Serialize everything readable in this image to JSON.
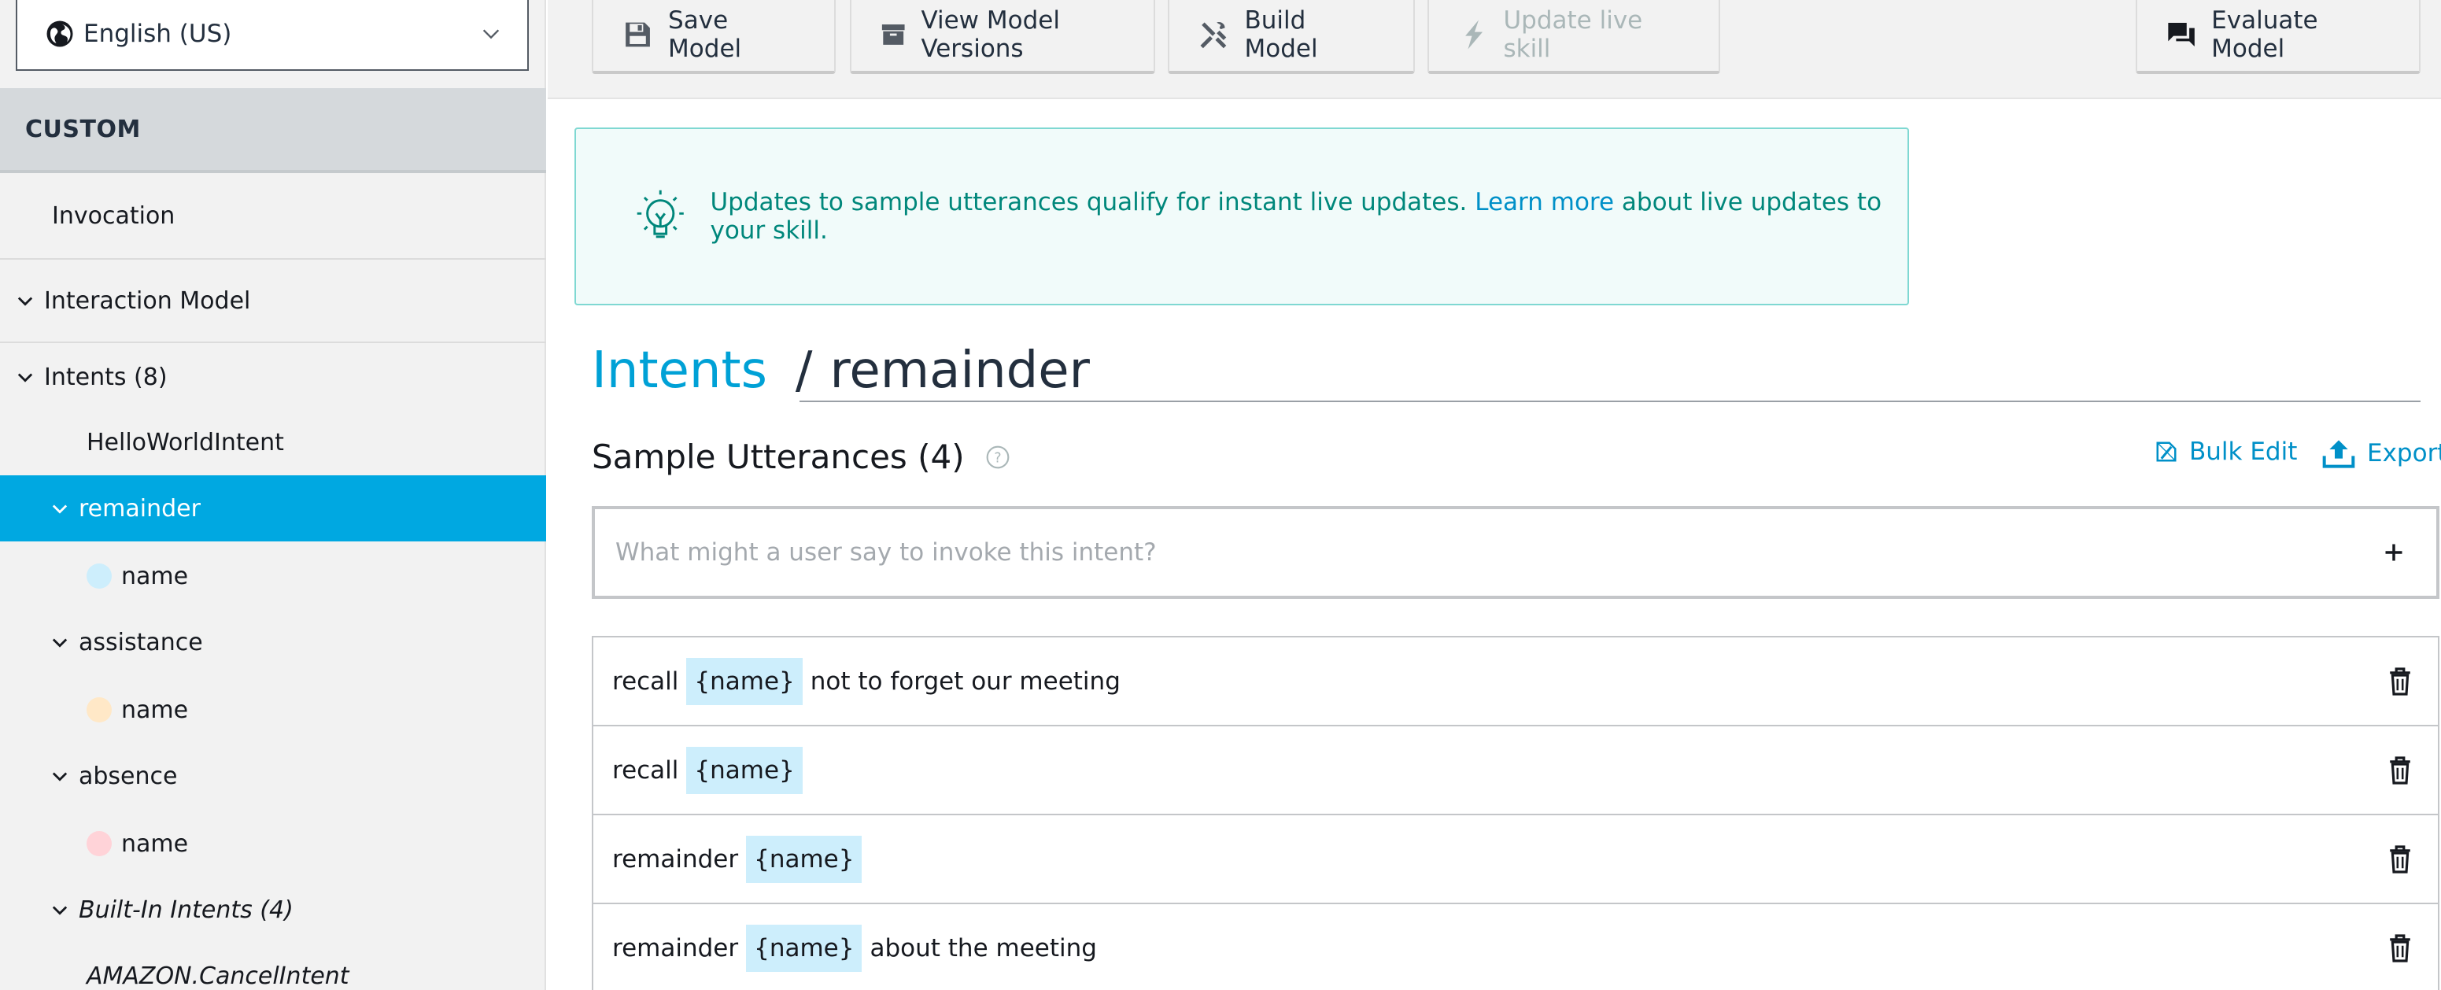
{
  "sidebar": {
    "language": "English (US)",
    "section_header": "CUSTOM",
    "invocation": "Invocation",
    "interaction_model": "Interaction Model",
    "intents_label": "Intents (8)",
    "hello_world": "HelloWorldIntent",
    "remainder": "remainder",
    "remainder_slot": "name",
    "assistance": "assistance",
    "assistance_slot": "name",
    "absence": "absence",
    "absence_slot": "name",
    "builtin_label": "Built-In Intents (4)",
    "cancel_intent": "AMAZON.CancelIntent",
    "slot_colors": [
      "#cdeefc",
      "#ffe8c7",
      "#ffd3d8"
    ]
  },
  "toolbar": {
    "save_model": "Save Model",
    "view_versions": "View Model Versions",
    "build_model": "Build Model",
    "update_live": "Update live skill",
    "evaluate_model": "Evaluate Model"
  },
  "banner": {
    "text_before": "Updates to sample utterances qualify for instant live updates.",
    "link": "Learn more",
    "text_after": "about live updates to your skill."
  },
  "breadcrumb": {
    "parent": "Intents",
    "separator": "/",
    "current": "remainder"
  },
  "utterances": {
    "title": "Sample Utterances (4)",
    "bulk_edit": "Bulk Edit",
    "export": "Export",
    "placeholder": "What might a user say to invoke this intent?",
    "rows": [
      {
        "before": "recall",
        "slot": "{name}",
        "after": "not to forget our meeting"
      },
      {
        "before": "recall",
        "slot": "{name}",
        "after": ""
      },
      {
        "before": "remainder",
        "slot": "{name}",
        "after": ""
      },
      {
        "before": "remainder",
        "slot": "{name}",
        "after": "about the meeting"
      }
    ]
  },
  "colors": {
    "accent": "#00a8e1",
    "link": "#0090c8",
    "banner_text": "#00877b"
  }
}
